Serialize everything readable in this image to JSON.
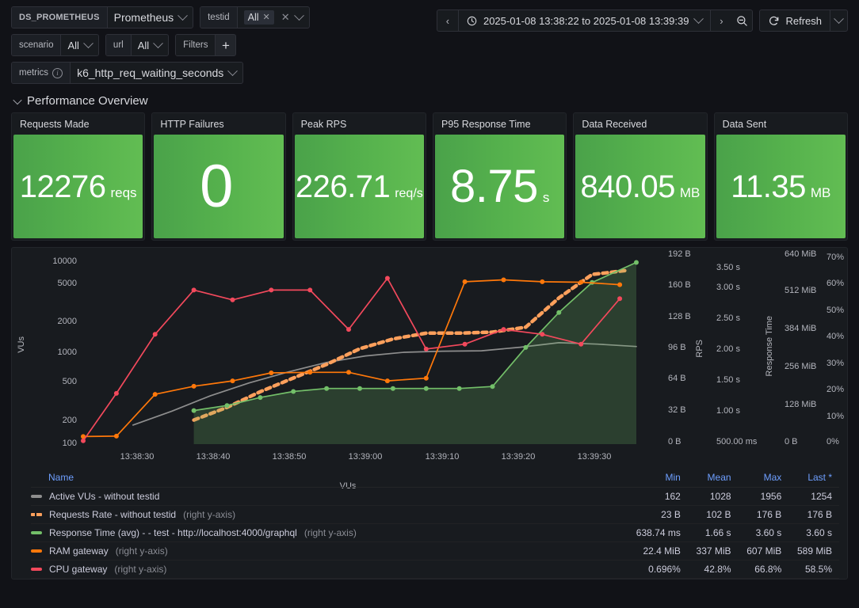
{
  "variables": [
    {
      "name": "datasource",
      "label": "DS_PROMETHEUS",
      "value": "Prometheus",
      "type": "select"
    },
    {
      "name": "testid",
      "label": "testid",
      "value": "All",
      "type": "multiselect"
    },
    {
      "name": "scenario",
      "label": "scenario",
      "value": "All",
      "type": "select"
    },
    {
      "name": "url",
      "label": "url",
      "value": "All",
      "type": "select"
    },
    {
      "name": "filters",
      "label": "Filters",
      "value": "+",
      "type": "adhoc"
    },
    {
      "name": "metrics",
      "label": "metrics",
      "value": "k6_http_req_waiting_seconds",
      "type": "select"
    }
  ],
  "timepicker": {
    "range": "2025-01-08 13:38:22 to 2025-01-08 13:39:39",
    "prev_title": "‹",
    "next_title": "›",
    "zoom_out_title": "Zoom out time range",
    "refresh_label": "Refresh"
  },
  "row": {
    "title": "Performance Overview",
    "collapsed": false
  },
  "stats": [
    {
      "title": "Requests Made",
      "value": "12276",
      "unit": "reqs",
      "color": "#56b24d"
    },
    {
      "title": "HTTP Failures",
      "value": "0",
      "unit": "",
      "color": "#56b24d"
    },
    {
      "title": "Peak RPS",
      "value": "226.71",
      "unit": "req/s",
      "color": "#56b24d"
    },
    {
      "title": "P95 Response Time",
      "value": "8.75",
      "unit": "s",
      "color": "#56b24d"
    },
    {
      "title": "Data Received",
      "value": "840.05",
      "unit": "MB",
      "color": "#56b24d"
    },
    {
      "title": "Data Sent",
      "value": "11.35",
      "unit": "MB",
      "color": "#56b24d"
    }
  ],
  "chart_data": {
    "type": "line",
    "title": "",
    "xlabel": "VUs",
    "grid": false,
    "legend_position": "bottom-table",
    "x_ticks": [
      "13:38:30",
      "13:38:40",
      "13:38:50",
      "13:39:00",
      "13:39:10",
      "13:39:20",
      "13:39:30"
    ],
    "x_range": [
      "13:38:22",
      "13:39:39"
    ],
    "axes": [
      {
        "id": "left-vus",
        "side": "left",
        "title": "VUs",
        "scale": "log",
        "ticks": [
          "100",
          "200",
          "500",
          "1000",
          "2000",
          "5000",
          "10000"
        ],
        "values": [
          100,
          200,
          500,
          1000,
          2000,
          5000,
          10000
        ]
      },
      {
        "id": "right-bytes",
        "side": "right",
        "title": "",
        "scale": "linear",
        "ticks": [
          "0 B",
          "32 B",
          "64 B",
          "96 B",
          "128 B",
          "160 B",
          "192 B"
        ],
        "values": [
          0,
          32,
          64,
          96,
          128,
          160,
          192
        ]
      },
      {
        "id": "right-rps",
        "side": "right",
        "title": "RPS",
        "scale": "linear",
        "ticks": [
          "500.00 ms",
          "1.00 s",
          "1.50 s",
          "2.00 s",
          "2.50 s",
          "3.00 s",
          "3.50 s"
        ],
        "values": [
          0.5,
          1.0,
          1.5,
          2.0,
          2.5,
          3.0,
          3.5
        ]
      },
      {
        "id": "right-resptime",
        "side": "right",
        "title": "Response Time",
        "scale": "linear",
        "ticks": [
          "0 B",
          "128 MiB",
          "256 MiB",
          "384 MiB",
          "512 MiB",
          "640 MiB"
        ],
        "values": [
          0,
          134217728,
          268435456,
          402653184,
          536870912,
          671088640
        ]
      },
      {
        "id": "right-pct",
        "side": "right",
        "title": "",
        "scale": "linear",
        "ticks": [
          "0%",
          "10%",
          "20%",
          "30%",
          "40%",
          "50%",
          "60%",
          "70%"
        ],
        "values": [
          0,
          10,
          20,
          30,
          40,
          50,
          60,
          70
        ]
      }
    ],
    "series": [
      {
        "name": "Active VUs - without testid",
        "color": "#8e8e8e",
        "style": "solid",
        "fill": false,
        "axis": "left-vus",
        "x": [
          0.09,
          0.16,
          0.23,
          0.3,
          0.37,
          0.44,
          0.51,
          0.58,
          0.65,
          0.72,
          0.79,
          0.86,
          0.93,
          1.0
        ],
        "values": [
          162,
          230,
          340,
          470,
          620,
          790,
          930,
          1020,
          1050,
          1060,
          1160,
          1300,
          1254,
          1180
        ]
      },
      {
        "name": "Requests Rate - without testid",
        "color": "#ffa05c",
        "style": "dashed",
        "fill": false,
        "axis": "right-bytes",
        "right_axis": true,
        "x": [
          0.2,
          0.26,
          0.32,
          0.38,
          0.44,
          0.5,
          0.56,
          0.62,
          0.68,
          0.74,
          0.8,
          0.86,
          0.92,
          0.98
        ],
        "values": [
          23,
          36,
          52,
          66,
          80,
          96,
          106,
          112,
          112,
          113,
          118,
          148,
          172,
          176
        ]
      },
      {
        "name": "Response Time (avg) - - test - http://localhost:4000/graphql",
        "color": "#73bf69",
        "style": "solid",
        "fill": true,
        "axis": "right-resptime",
        "right_axis": true,
        "x": [
          0.2,
          0.26,
          0.32,
          0.38,
          0.44,
          0.5,
          0.56,
          0.62,
          0.68,
          0.74,
          0.8,
          0.86,
          0.92,
          1.0
        ],
        "values": [
          0.64,
          0.74,
          0.9,
          1.02,
          1.08,
          1.08,
          1.08,
          1.08,
          1.08,
          1.12,
          1.9,
          2.6,
          3.2,
          3.6
        ]
      },
      {
        "name": "RAM gateway",
        "color": "#ff780a",
        "style": "solid",
        "fill": false,
        "axis": "right-resptime",
        "right_axis": true,
        "x": [
          0.0,
          0.06,
          0.13,
          0.2,
          0.27,
          0.34,
          0.41,
          0.48,
          0.55,
          0.62,
          0.69,
          0.76,
          0.83,
          0.9,
          0.97
        ],
        "values": [
          22.4,
          24.0,
          180,
          210,
          230,
          260,
          262,
          262,
          230,
          240,
          600,
          607,
          600,
          598,
          589
        ]
      },
      {
        "name": "CPU gateway",
        "color": "#f2495c",
        "style": "solid",
        "fill": false,
        "axis": "right-pct",
        "right_axis": true,
        "x": [
          0.0,
          0.06,
          0.13,
          0.2,
          0.27,
          0.34,
          0.41,
          0.48,
          0.55,
          0.62,
          0.69,
          0.76,
          0.83,
          0.9,
          0.97
        ],
        "values": [
          0.696,
          20,
          44,
          62,
          58,
          62,
          62,
          46,
          66.8,
          38,
          40,
          46,
          44,
          40,
          58.5
        ]
      }
    ]
  },
  "legend": {
    "columns": [
      "Name",
      "Min",
      "Mean",
      "Max",
      "Last *"
    ],
    "rows": [
      {
        "name": "Active VUs - without testid",
        "suffix": "",
        "color": "#8e8e8e",
        "style": "solid",
        "min": "162",
        "mean": "1028",
        "max": "1956",
        "last": "1254"
      },
      {
        "name": "Requests Rate - without testid",
        "suffix": "(right y-axis)",
        "color": "#ffa05c",
        "style": "dashed",
        "min": "23 B",
        "mean": "102 B",
        "max": "176 B",
        "last": "176 B"
      },
      {
        "name": "Response Time (avg) - - test - http://localhost:4000/graphql",
        "suffix": "(right y-axis)",
        "color": "#73bf69",
        "style": "solid",
        "min": "638.74 ms",
        "mean": "1.66 s",
        "max": "3.60 s",
        "last": "3.60 s"
      },
      {
        "name": "RAM gateway",
        "suffix": "(right y-axis)",
        "color": "#ff780a",
        "style": "solid",
        "min": "22.4 MiB",
        "mean": "337 MiB",
        "max": "607 MiB",
        "last": "589 MiB"
      },
      {
        "name": "CPU gateway",
        "suffix": "(right y-axis)",
        "color": "#f2495c",
        "style": "solid",
        "min": "0.696%",
        "mean": "42.8%",
        "max": "66.8%",
        "last": "58.5%"
      }
    ]
  }
}
